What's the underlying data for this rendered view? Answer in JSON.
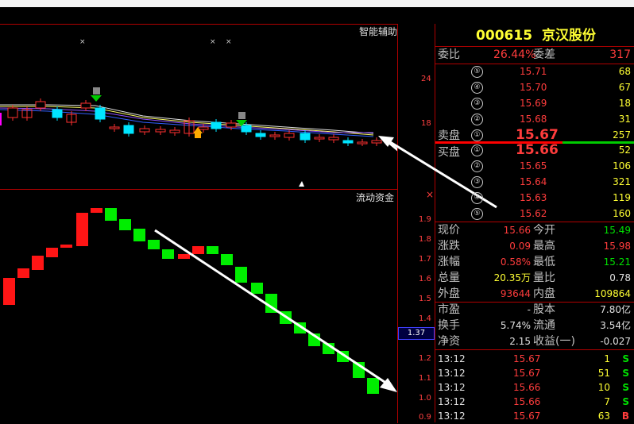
{
  "chart_top": {
    "indicator_label": "智能辅助",
    "axis_ticks": [
      "24",
      "18"
    ],
    "sell_signal_label": "S",
    "buy_signal_label": "B"
  },
  "chart_bottom": {
    "indicator_label": "流动资金",
    "axis_ticks": [
      "1.9",
      "1.8",
      "1.7",
      "1.6",
      "1.5",
      "1.4",
      "1.2",
      "1.1",
      "1.0",
      "0.9"
    ],
    "current_value": "1.37",
    "close_glyph": "×"
  },
  "quote": {
    "code": "000615",
    "name": "京汉股份",
    "weibi_label": "委比",
    "weibi_value": "26.44%",
    "weicha_label": "委差",
    "weicha_value": "317",
    "sell_label": "卖盘",
    "buy_label": "买盘",
    "asks": [
      {
        "idx": "⑤",
        "price": "15.71",
        "vol": "68"
      },
      {
        "idx": "④",
        "price": "15.70",
        "vol": "67"
      },
      {
        "idx": "③",
        "price": "15.69",
        "vol": "18"
      },
      {
        "idx": "②",
        "price": "15.68",
        "vol": "31"
      },
      {
        "idx": "①",
        "price": "15.67",
        "vol": "257"
      }
    ],
    "bids": [
      {
        "idx": "①",
        "price": "15.66",
        "vol": "52"
      },
      {
        "idx": "②",
        "price": "15.65",
        "vol": "106"
      },
      {
        "idx": "③",
        "price": "15.64",
        "vol": "321"
      },
      {
        "idx": "④",
        "price": "15.63",
        "vol": "119"
      },
      {
        "idx": "⑤",
        "price": "15.62",
        "vol": "160"
      }
    ],
    "stats": [
      {
        "l1": "现价",
        "v1": "15.66",
        "l2": "今开",
        "v2": "15.49"
      },
      {
        "l1": "涨跌",
        "v1": "0.09",
        "l2": "最高",
        "v2": "15.98"
      },
      {
        "l1": "涨幅",
        "v1": "0.58%",
        "l2": "最低",
        "v2": "15.21"
      },
      {
        "l1": "总量",
        "v1": "20.35万",
        "l2": "量比",
        "v2": "0.78"
      },
      {
        "l1": "外盘",
        "v1": "93644",
        "l2": "内盘",
        "v2": "109864"
      }
    ],
    "fund": [
      {
        "l1": "市盈",
        "v1": "-",
        "l2": "股本",
        "v2": "7.80亿"
      },
      {
        "l1": "换手",
        "v1": "5.74%",
        "l2": "流通",
        "v2": "3.54亿"
      },
      {
        "l1": "净资",
        "v1": "2.15",
        "l2": "收益(一)",
        "v2": "-0.027"
      }
    ],
    "ticks": [
      {
        "time": "13:12",
        "price": "15.67",
        "vol": "1",
        "side": "S"
      },
      {
        "time": "13:12",
        "price": "15.67",
        "vol": "51",
        "side": "S"
      },
      {
        "time": "13:12",
        "price": "15.66",
        "vol": "10",
        "side": "S"
      },
      {
        "time": "13:12",
        "price": "15.66",
        "vol": "7",
        "side": "S"
      },
      {
        "time": "13:12",
        "price": "15.67",
        "vol": "63",
        "side": "B"
      }
    ]
  },
  "colors": {
    "up": "#ff2020",
    "down": "#00ee00",
    "cyan": "#00e5ff",
    "border": "#b00000"
  }
}
